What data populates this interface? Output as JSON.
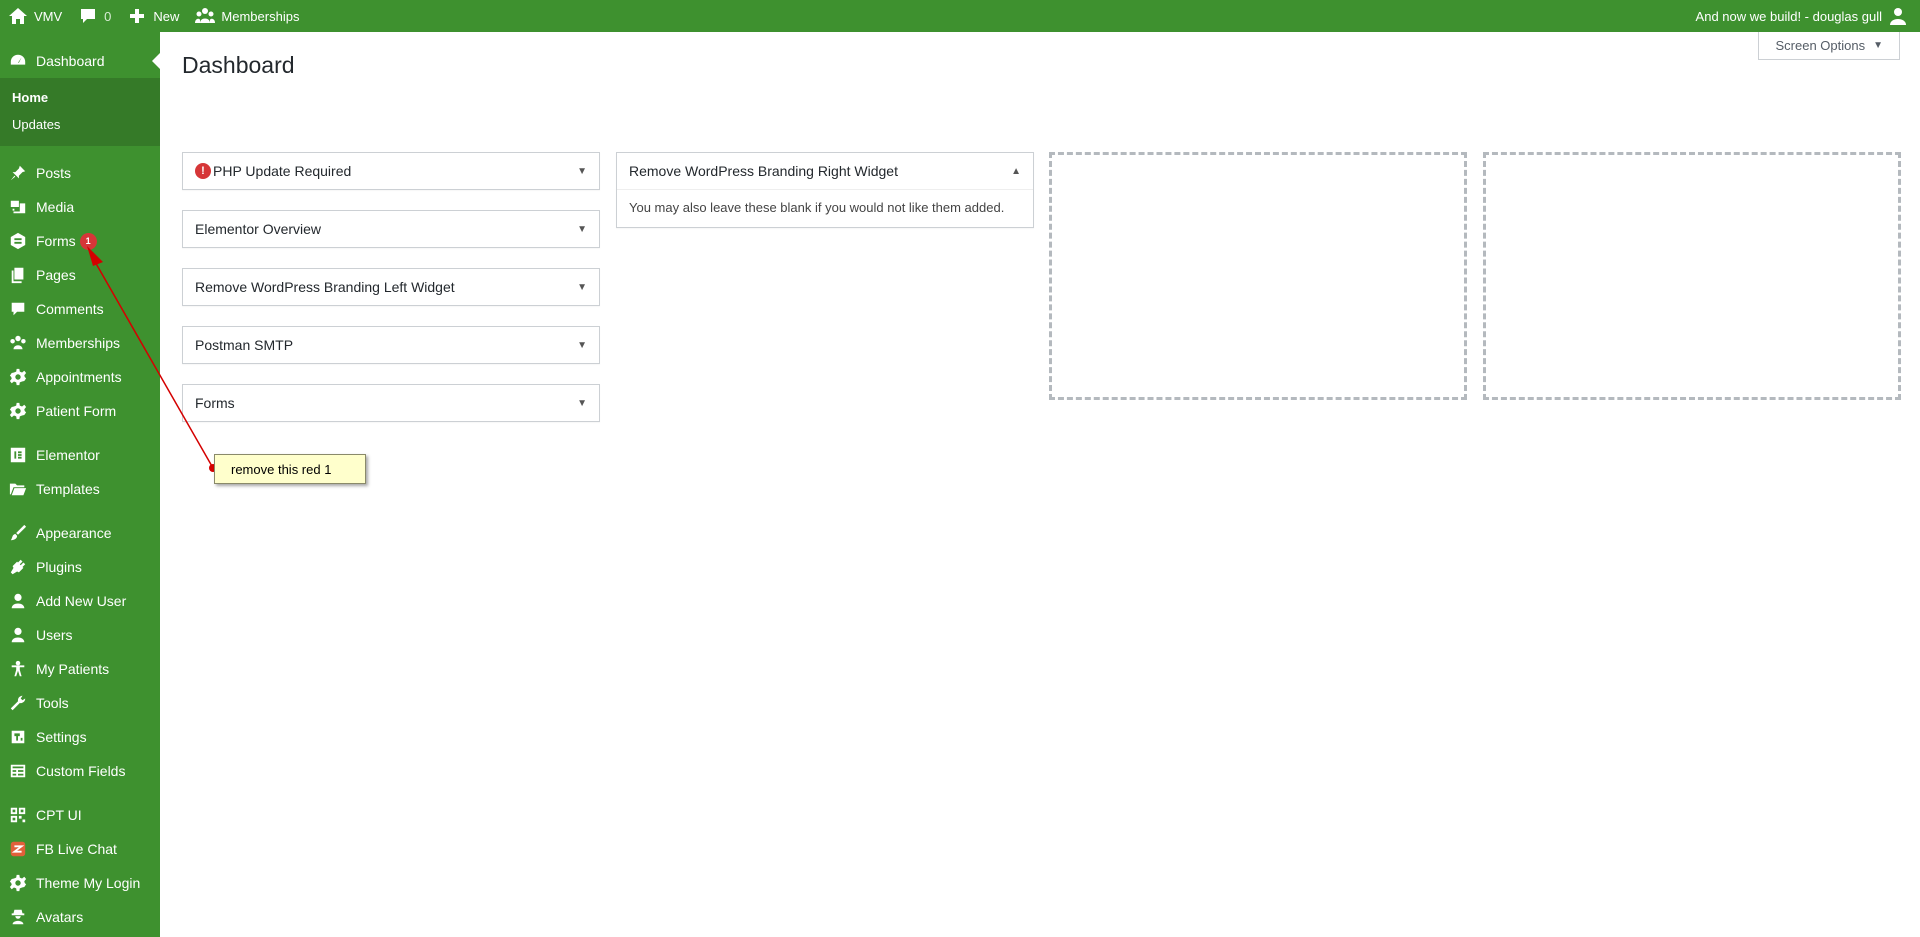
{
  "adminbar": {
    "site_name": "VMV",
    "comments_count": "0",
    "new_label": "New",
    "memberships_label": "Memberships",
    "greeting": "And now we build! - douglas gull"
  },
  "sidebar": {
    "dashboard_label": "Dashboard",
    "submenu": [
      "Home",
      "Updates"
    ],
    "items": [
      {
        "label": "Posts",
        "icon": "pin-icon"
      },
      {
        "label": "Media",
        "icon": "media-icon"
      },
      {
        "label": "Forms",
        "icon": "forms-icon",
        "badge": "1"
      },
      {
        "label": "Pages",
        "icon": "pages-icon"
      },
      {
        "label": "Comments",
        "icon": "comment-icon"
      },
      {
        "label": "Memberships",
        "icon": "groups-icon"
      },
      {
        "label": "Appointments",
        "icon": "gear-icon"
      },
      {
        "label": "Patient Form",
        "icon": "gear-icon"
      },
      {
        "label": "Elementor",
        "icon": "elementor-icon"
      },
      {
        "label": "Templates",
        "icon": "folder-icon"
      },
      {
        "label": "Appearance",
        "icon": "brush-icon"
      },
      {
        "label": "Plugins",
        "icon": "plug-icon"
      },
      {
        "label": "Add New User",
        "icon": "user-icon"
      },
      {
        "label": "Users",
        "icon": "user-icon"
      },
      {
        "label": "My Patients",
        "icon": "person-icon"
      },
      {
        "label": "Tools",
        "icon": "wrench-icon"
      },
      {
        "label": "Settings",
        "icon": "settings-icon"
      },
      {
        "label": "Custom Fields",
        "icon": "table-icon"
      },
      {
        "label": "CPT UI",
        "icon": "grid-icon"
      },
      {
        "label": "FB Live Chat",
        "icon": "chat-icon"
      },
      {
        "label": "Theme My Login",
        "icon": "gear-icon"
      },
      {
        "label": "Avatars",
        "icon": "avatar-icon"
      }
    ]
  },
  "main": {
    "title": "Dashboard",
    "screen_options": "Screen Options",
    "left_widgets": [
      "PHP Update Required",
      "Elementor Overview",
      "Remove WordPress Branding Left Widget",
      "Postman SMTP",
      "Forms"
    ],
    "right_widget": {
      "title": "Remove WordPress Branding Right Widget",
      "body": "You may also leave these blank if you would not like them added."
    }
  },
  "annotation": {
    "note": "remove this red 1"
  },
  "colors": {
    "brand_green": "#3e912f",
    "submenu_green": "#357a28",
    "badge_red": "#d63638",
    "annotation_red": "#d40000",
    "note_bg": "#ffffcc"
  }
}
